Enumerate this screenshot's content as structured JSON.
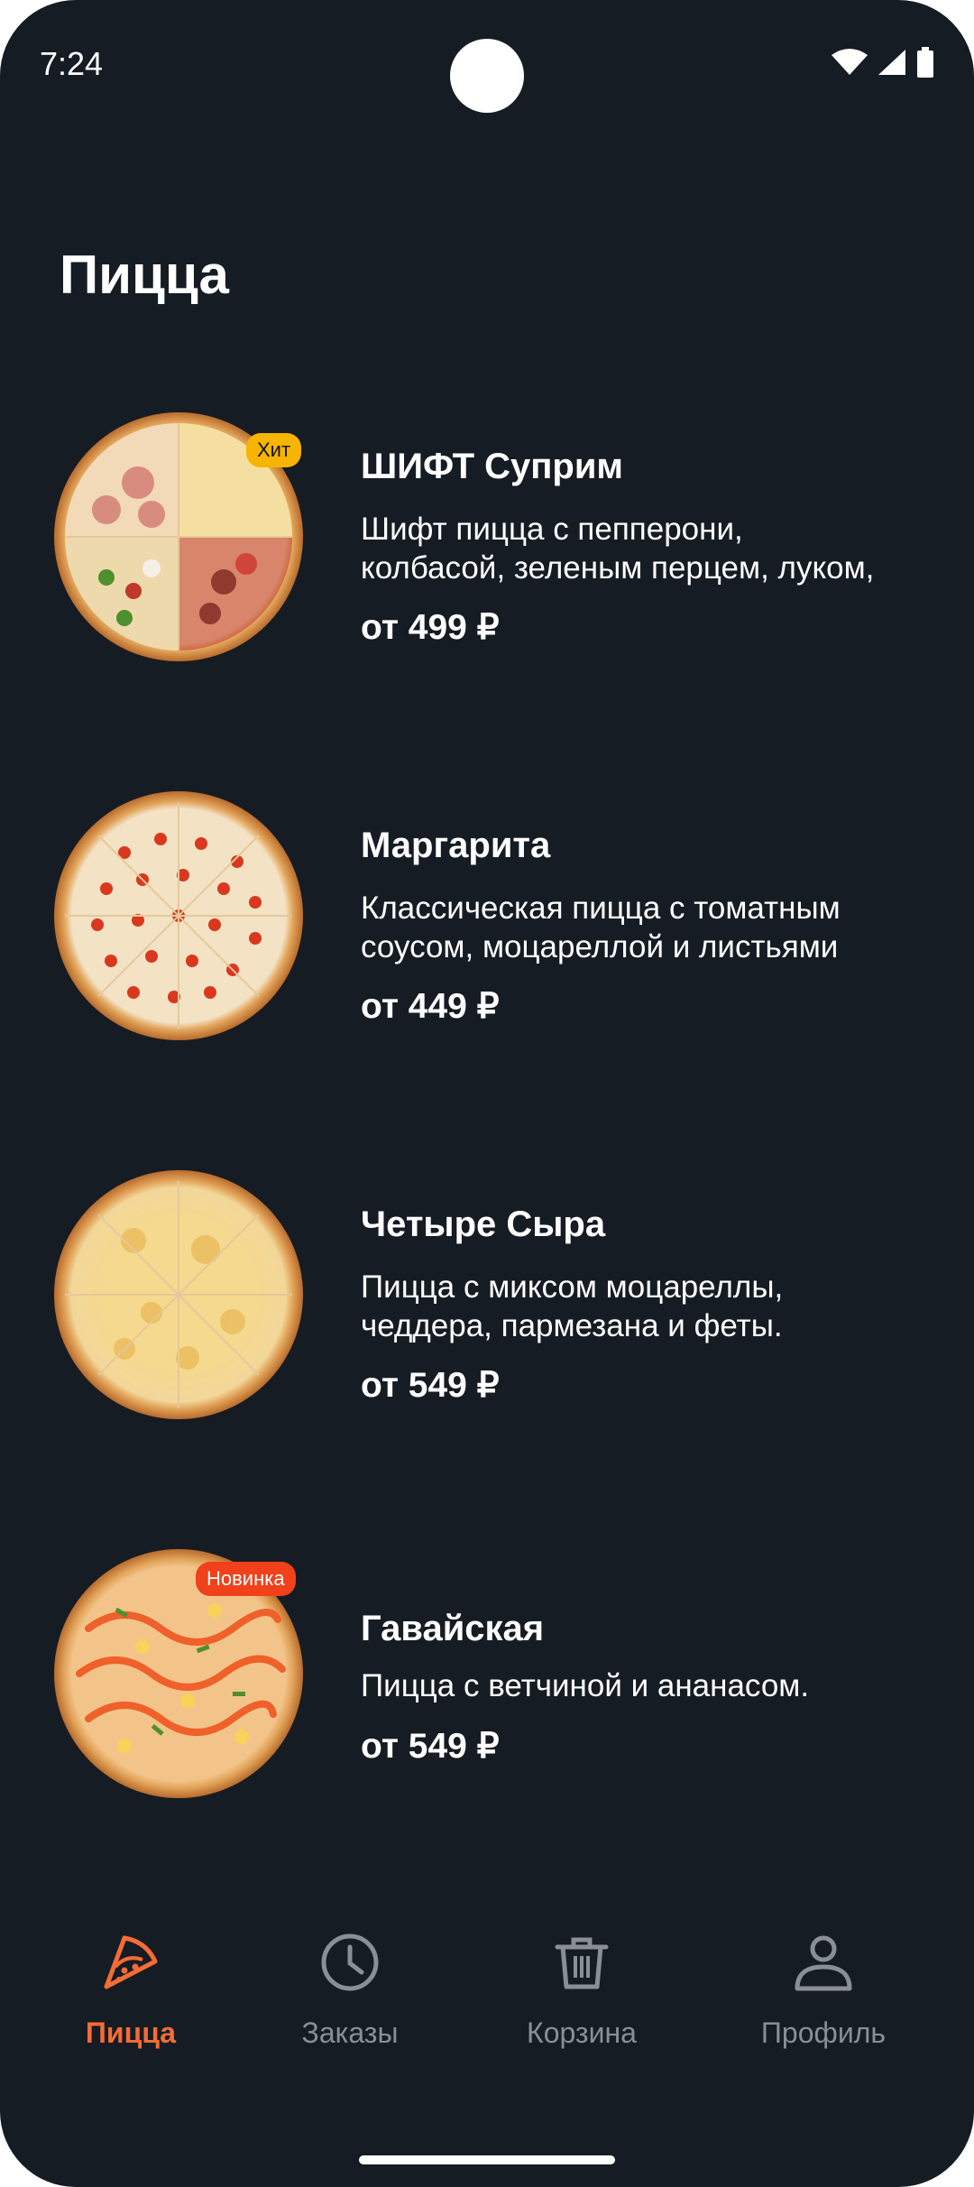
{
  "status_bar": {
    "time": "7:24"
  },
  "page": {
    "title": "Пицца"
  },
  "menu": [
    {
      "name": "ШИФТ Суприм",
      "desc_line1": "Шифт пицца с пепперони,",
      "desc_line2": "колбасой, зеленым перцем, луком,",
      "price": "от 499 ₽",
      "badge": "Хит",
      "badge_color": "#F7B400"
    },
    {
      "name": "Маргарита",
      "desc_line1": "Классическая пицца с томатным",
      "desc_line2": "соусом, моцареллой и листьями",
      "price": "от 449 ₽",
      "badge": "",
      "badge_color": ""
    },
    {
      "name": "Четыре Сыра",
      "desc_line1": "Пицца с миксом моцареллы,",
      "desc_line2": "чеддера, пармезана и феты.",
      "price": "от 549 ₽",
      "badge": "",
      "badge_color": ""
    },
    {
      "name": "Гавайская",
      "desc_line1": "Пицца с ветчиной и ананасом.",
      "desc_line2": "",
      "price": "от 549 ₽",
      "badge": "Новинка",
      "badge_color": "#F0411B"
    }
  ],
  "nav": {
    "items": [
      {
        "label": "Пицца",
        "icon": "pizza-slice-icon",
        "active": true
      },
      {
        "label": "Заказы",
        "icon": "clock-icon",
        "active": false
      },
      {
        "label": "Корзина",
        "icon": "trash-basket-icon",
        "active": false
      },
      {
        "label": "Профиль",
        "icon": "person-icon",
        "active": false
      }
    ]
  },
  "colors": {
    "background": "#161C23",
    "accent": "#F46C36",
    "inactive": "#8A8F96"
  }
}
